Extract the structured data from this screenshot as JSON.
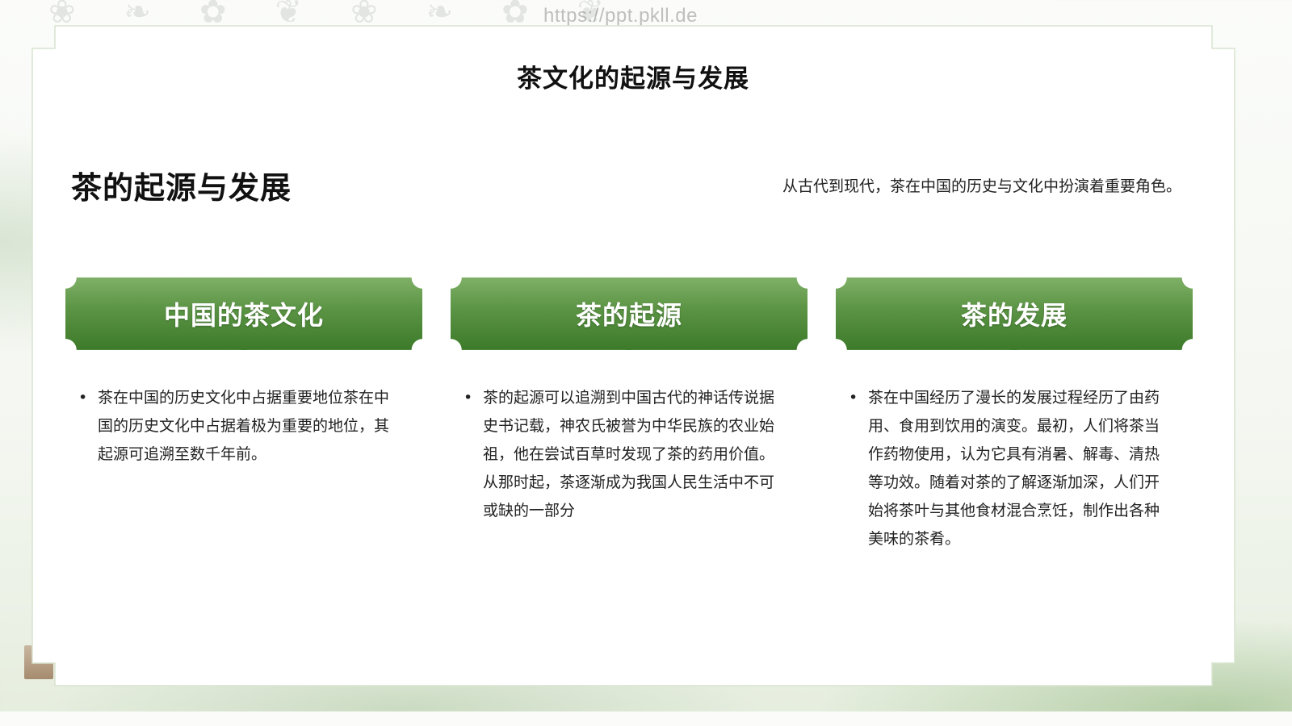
{
  "watermark": "https://ppt.pkll.de",
  "title": "茶文化的起源与发展",
  "section": {
    "heading": "茶的起源与发展",
    "description": "从古代到现代，茶在中国的历史与文化中扮演着重要角色。"
  },
  "cards": [
    {
      "title": "中国的茶文化",
      "text": "茶在中国的历史文化中占据重要地位茶在中国的历史文化中占据着极为重要的地位，其起源可追溯至数千年前。"
    },
    {
      "title": "茶的起源",
      "text": "茶的起源可以追溯到中国古代的神话传说据史书记载，神农氏被誉为中华民族的农业始祖，他在尝试百草时发现了茶的药用价值。从那时起，茶逐渐成为我国人民生活中不可或缺的一部分"
    },
    {
      "title": "茶的发展",
      "text": "茶在中国经历了漫长的发展过程经历了由药用、食用到饮用的演变。最初，人们将茶当作药物使用，认为它具有消暑、解毒、清热等功效。随着对茶的了解逐渐加深，人们开始将茶叶与其他食材混合烹饪，制作出各种美味的茶肴。"
    }
  ],
  "colors": {
    "header_top": "#7fb067",
    "header_bottom": "#3c7a2a",
    "text": "#222222"
  }
}
